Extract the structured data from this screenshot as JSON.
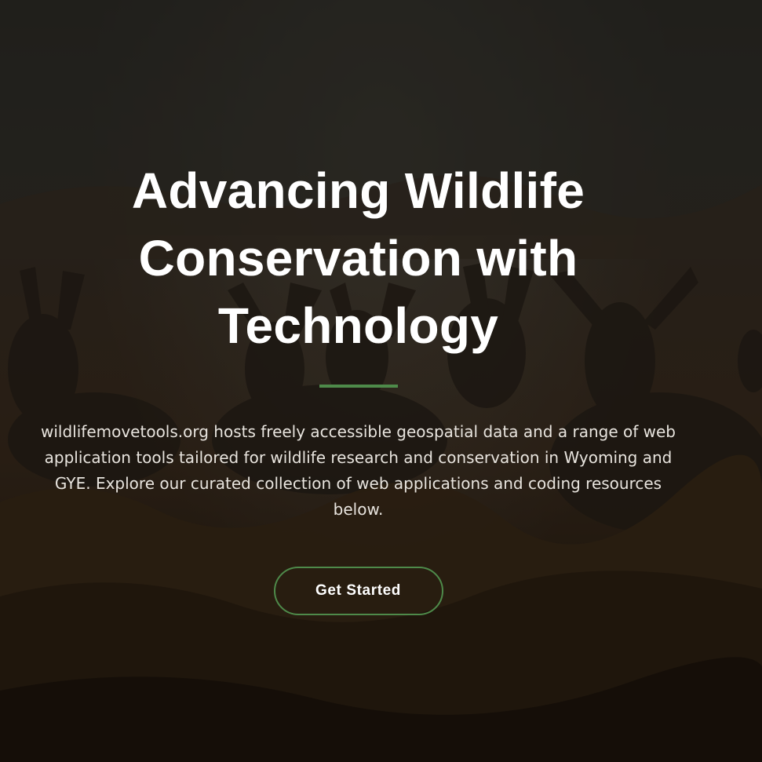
{
  "hero": {
    "headline": "Advancing Wildlife Conservation with Technology",
    "description": "wildlifemovetools.org hosts freely accessible geospatial data and a range of web application tools tailored for wildlife research and conservation in Wyoming and GYE. Explore our curated collection of web applications and coding resources below.",
    "cta_label": "Get Started",
    "background_image": "mule deer herd in sagebrush grassland at dusk"
  },
  "colors": {
    "accent": "#4e8a4a",
    "heading_text": "#ffffff",
    "body_text": "#e8e4de"
  }
}
